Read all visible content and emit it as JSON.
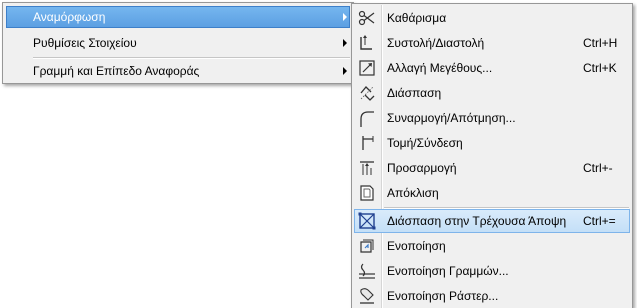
{
  "main_menu": {
    "items": [
      {
        "label": "Αναμόρφωση"
      },
      {
        "label": "Ρυθμίσεις Στοιχείου"
      },
      {
        "label": "Γραμμή και Επίπεδο Αναφοράς"
      }
    ]
  },
  "submenu": {
    "items": [
      {
        "label": "Καθάρισμα",
        "shortcut": "",
        "icon": "trim-scissors-icon"
      },
      {
        "label": "Συστολή/Διαστολή",
        "shortcut": "Ctrl+H",
        "icon": "adjust-icon"
      },
      {
        "label": "Αλλαγή Μεγέθους...",
        "shortcut": "Ctrl+K",
        "icon": "resize-icon"
      },
      {
        "label": "Διάσπαση",
        "shortcut": "",
        "icon": "split-icon"
      },
      {
        "label": "Συναρμογή/Απότμηση...",
        "shortcut": "",
        "icon": "fillet-chamfer-icon"
      },
      {
        "label": "Τομή/Σύνδεση",
        "shortcut": "",
        "icon": "intersect-icon"
      },
      {
        "label": "Προσαρμογή",
        "shortcut": "Ctrl+-",
        "icon": "adjust-elements-icon"
      },
      {
        "label": "Απόκλιση",
        "shortcut": "",
        "icon": "offset-icon"
      },
      {
        "label": "Διάσπαση στην Τρέχουσα Άποψη",
        "shortcut": "Ctrl+=",
        "icon": "explode-into-current-view-icon"
      },
      {
        "label": "Ενοποίηση",
        "shortcut": "",
        "icon": "unify-icon"
      },
      {
        "label": "Ενοποίηση Γραμμών...",
        "shortcut": "",
        "icon": "unify-lines-icon"
      },
      {
        "label": "Ενοποίηση Ράστερ...",
        "shortcut": "",
        "icon": "unify-raster-icon"
      }
    ]
  }
}
